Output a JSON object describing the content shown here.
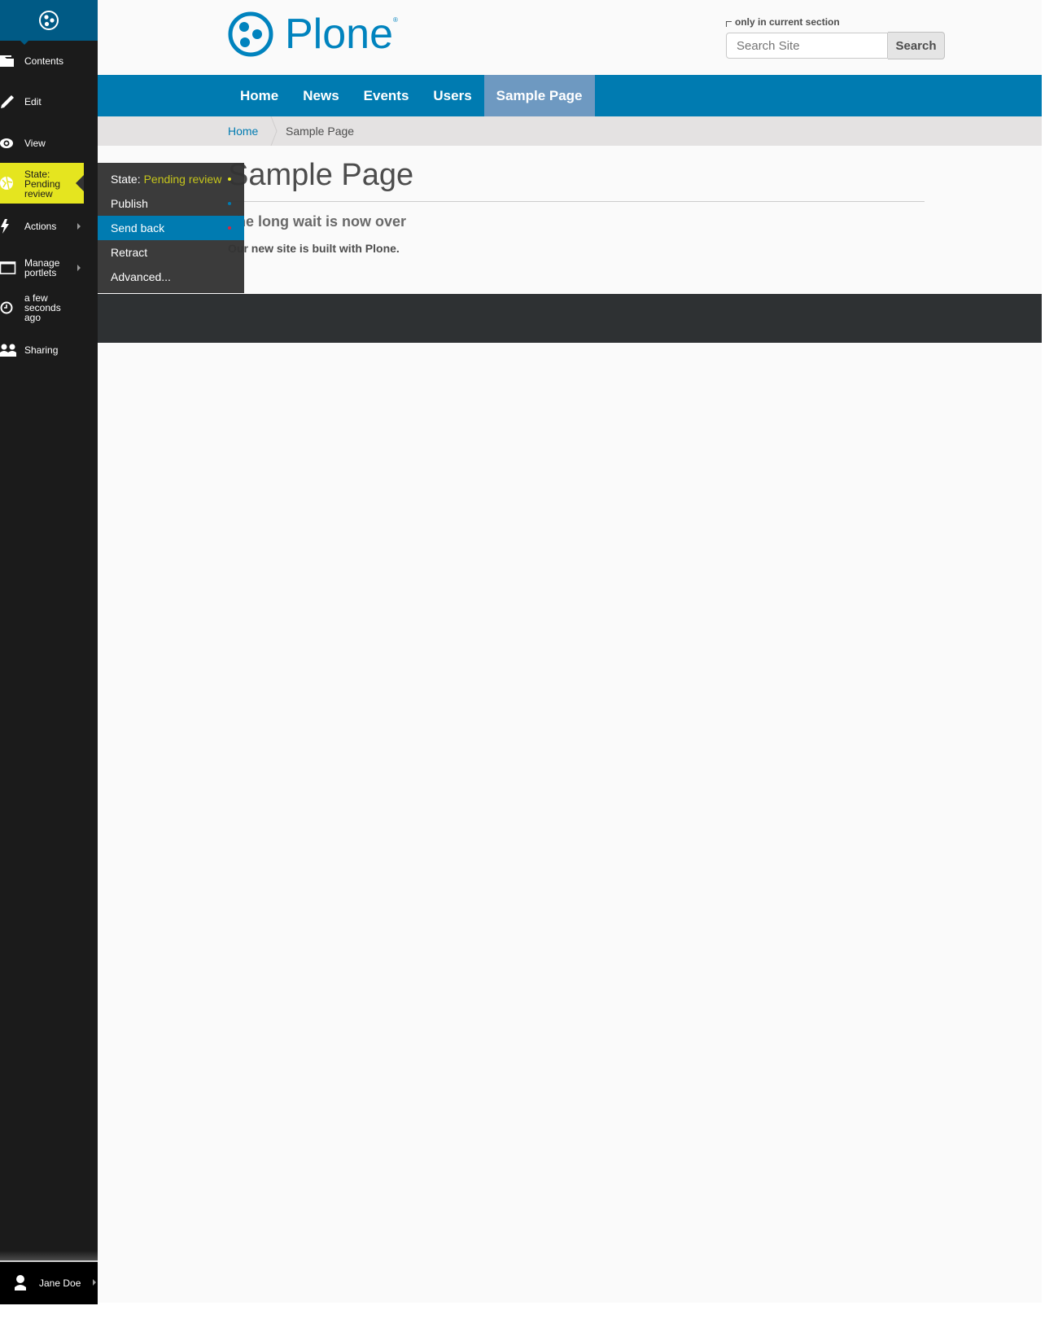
{
  "toolbar": {
    "items": [
      {
        "label": "Contents",
        "icon": "folder-icon"
      },
      {
        "label": "Edit",
        "icon": "pencil-icon"
      },
      {
        "label": "View",
        "icon": "eye-icon"
      },
      {
        "label": "State:\nPending\nreview",
        "icon": "state-icon"
      },
      {
        "label": "Actions",
        "icon": "bolt-icon"
      },
      {
        "label": "Manage\nportlets",
        "icon": "portlet-icon"
      },
      {
        "label": "a few\nseconds\nago",
        "icon": "clock-icon"
      },
      {
        "label": "Sharing",
        "icon": "users-icon"
      }
    ],
    "state_line1": "State:",
    "state_line2": "Pending",
    "state_line3": "review",
    "manage_line1": "Manage",
    "manage_line2": "portlets",
    "history_line1": "a few",
    "history_line2": "seconds",
    "history_line3": "ago",
    "user": "Jane Doe"
  },
  "header": {
    "logo_text": "Plone",
    "logo_reg": "®",
    "search_option": "only in current section",
    "search_placeholder": "Search Site",
    "search_button": "Search"
  },
  "nav": {
    "items": [
      "Home",
      "News",
      "Events",
      "Users",
      "Sample Page"
    ],
    "active": "Sample Page"
  },
  "breadcrumbs": {
    "home": "Home",
    "current": "Sample Page"
  },
  "content": {
    "title": "Sample Page",
    "description": "The long wait is now over",
    "body": "Our new site is built with Plone."
  },
  "state_menu": {
    "state_label": "State:",
    "state_value": "Pending review",
    "items": [
      {
        "label": "Publish",
        "dot_color": "#007bb1"
      },
      {
        "label": "Send back",
        "dot_color": "#d7263d",
        "highlighted": true
      },
      {
        "label": "Retract"
      },
      {
        "label": "Advanced..."
      }
    ],
    "state_dot_color": "#e5e51f"
  },
  "colors": {
    "brand": "#0083be",
    "nav": "#007bb1",
    "nav_active": "#6e99c1",
    "state_yellow": "#e5e51f",
    "toolbar_header": "#005a85"
  }
}
